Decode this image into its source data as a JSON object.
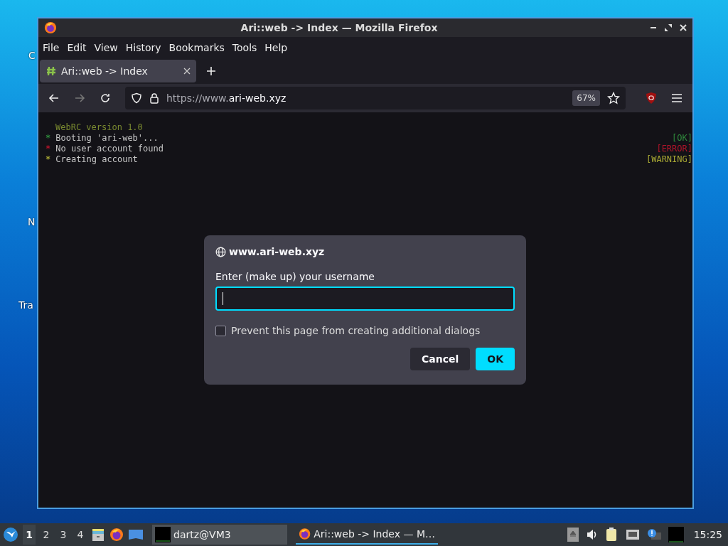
{
  "desktop": {
    "labels": [
      "C",
      "N",
      "Tra"
    ]
  },
  "window": {
    "title": "Ari::web -> Index — Mozilla Firefox"
  },
  "menu": [
    "File",
    "Edit",
    "View",
    "History",
    "Bookmarks",
    "Tools",
    "Help"
  ],
  "tabs": [
    {
      "label": "Ari::web -> Index",
      "selected": true
    }
  ],
  "address": {
    "prefix": "https://www.",
    "domain": "ari-web.xyz",
    "zoom": "67%"
  },
  "console": [
    {
      "kind": "header",
      "text": "WebRC version 1.0"
    },
    {
      "kind": "log",
      "bullet": "*",
      "color": "#2f8a3c",
      "text": "Booting 'ari-web'...",
      "status": "[OK]"
    },
    {
      "kind": "log",
      "bullet": "*",
      "color": "#b0142a",
      "text": "No user account found",
      "status": "[ERROR]"
    },
    {
      "kind": "log",
      "bullet": "*",
      "color": "#a8a834",
      "text": "Creating account",
      "status": "[WARNING]"
    }
  ],
  "dialog": {
    "site": "www.ari-web.xyz",
    "label": "Enter (make up) your username",
    "checkbox": {
      "label": "Prevent this page from creating additional dialogs",
      "checked": false
    },
    "buttons": [
      {
        "label": "Cancel",
        "kind": "secondary"
      },
      {
        "label": "OK",
        "kind": "primary"
      }
    ]
  },
  "taskbar": {
    "workspaces": [
      {
        "label": "1",
        "selected": true
      },
      {
        "label": "2",
        "selected": false
      },
      {
        "label": "3",
        "selected": false
      },
      {
        "label": "4",
        "selected": false
      }
    ],
    "tasks": [
      {
        "label": "dartz@VM3",
        "kind": "terminal",
        "selected": false
      },
      {
        "label": "Ari::web -> Index — M…",
        "kind": "browser",
        "selected": true
      }
    ],
    "clock": "15:25"
  }
}
